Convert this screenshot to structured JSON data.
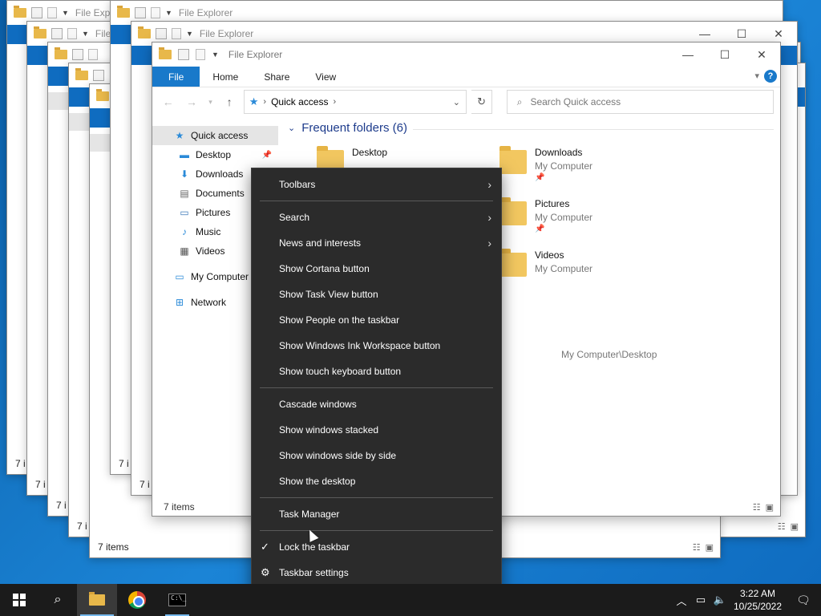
{
  "window": {
    "title": "File Explorer",
    "tabs": [
      "File",
      "Home",
      "Share",
      "View"
    ],
    "help": "?"
  },
  "navbar": {
    "address_root": "Quick access",
    "search_placeholder": "Search Quick access"
  },
  "navpane": {
    "quick_access": "Quick access",
    "items": [
      "Desktop",
      "Downloads",
      "Documents",
      "Pictures",
      "Music",
      "Videos"
    ],
    "my_computer": "My Computer",
    "network": "Network"
  },
  "main": {
    "group_header": "Frequent folders (6)",
    "tiles": [
      {
        "name": "Desktop",
        "sub": ""
      },
      {
        "name": "Downloads",
        "sub": "My Computer"
      },
      {
        "name": "Pictures",
        "sub": "My Computer"
      },
      {
        "name": "Videos",
        "sub": "My Computer"
      }
    ],
    "path_note": "My Computer\\Desktop"
  },
  "status": {
    "front": "7 items",
    "back": "7 items",
    "back_clipped": "7 i"
  },
  "context_menu": {
    "items": [
      {
        "label": "Toolbars",
        "submenu": true
      },
      {
        "sep": true
      },
      {
        "label": "Search",
        "submenu": true
      },
      {
        "label": "News and interests",
        "submenu": true
      },
      {
        "label": "Show Cortana button"
      },
      {
        "label": "Show Task View button"
      },
      {
        "label": "Show People on the taskbar"
      },
      {
        "label": "Show Windows Ink Workspace button"
      },
      {
        "label": "Show touch keyboard button"
      },
      {
        "sep": true
      },
      {
        "label": "Cascade windows"
      },
      {
        "label": "Show windows stacked"
      },
      {
        "label": "Show windows side by side"
      },
      {
        "label": "Show the desktop"
      },
      {
        "sep": true
      },
      {
        "label": "Task Manager"
      },
      {
        "sep": true
      },
      {
        "label": "Lock the taskbar",
        "checked": true
      },
      {
        "label": "Taskbar settings",
        "icon": "gear-icon"
      }
    ]
  },
  "taskbar": {
    "time": "3:22 AM",
    "date": "10/25/2022"
  }
}
